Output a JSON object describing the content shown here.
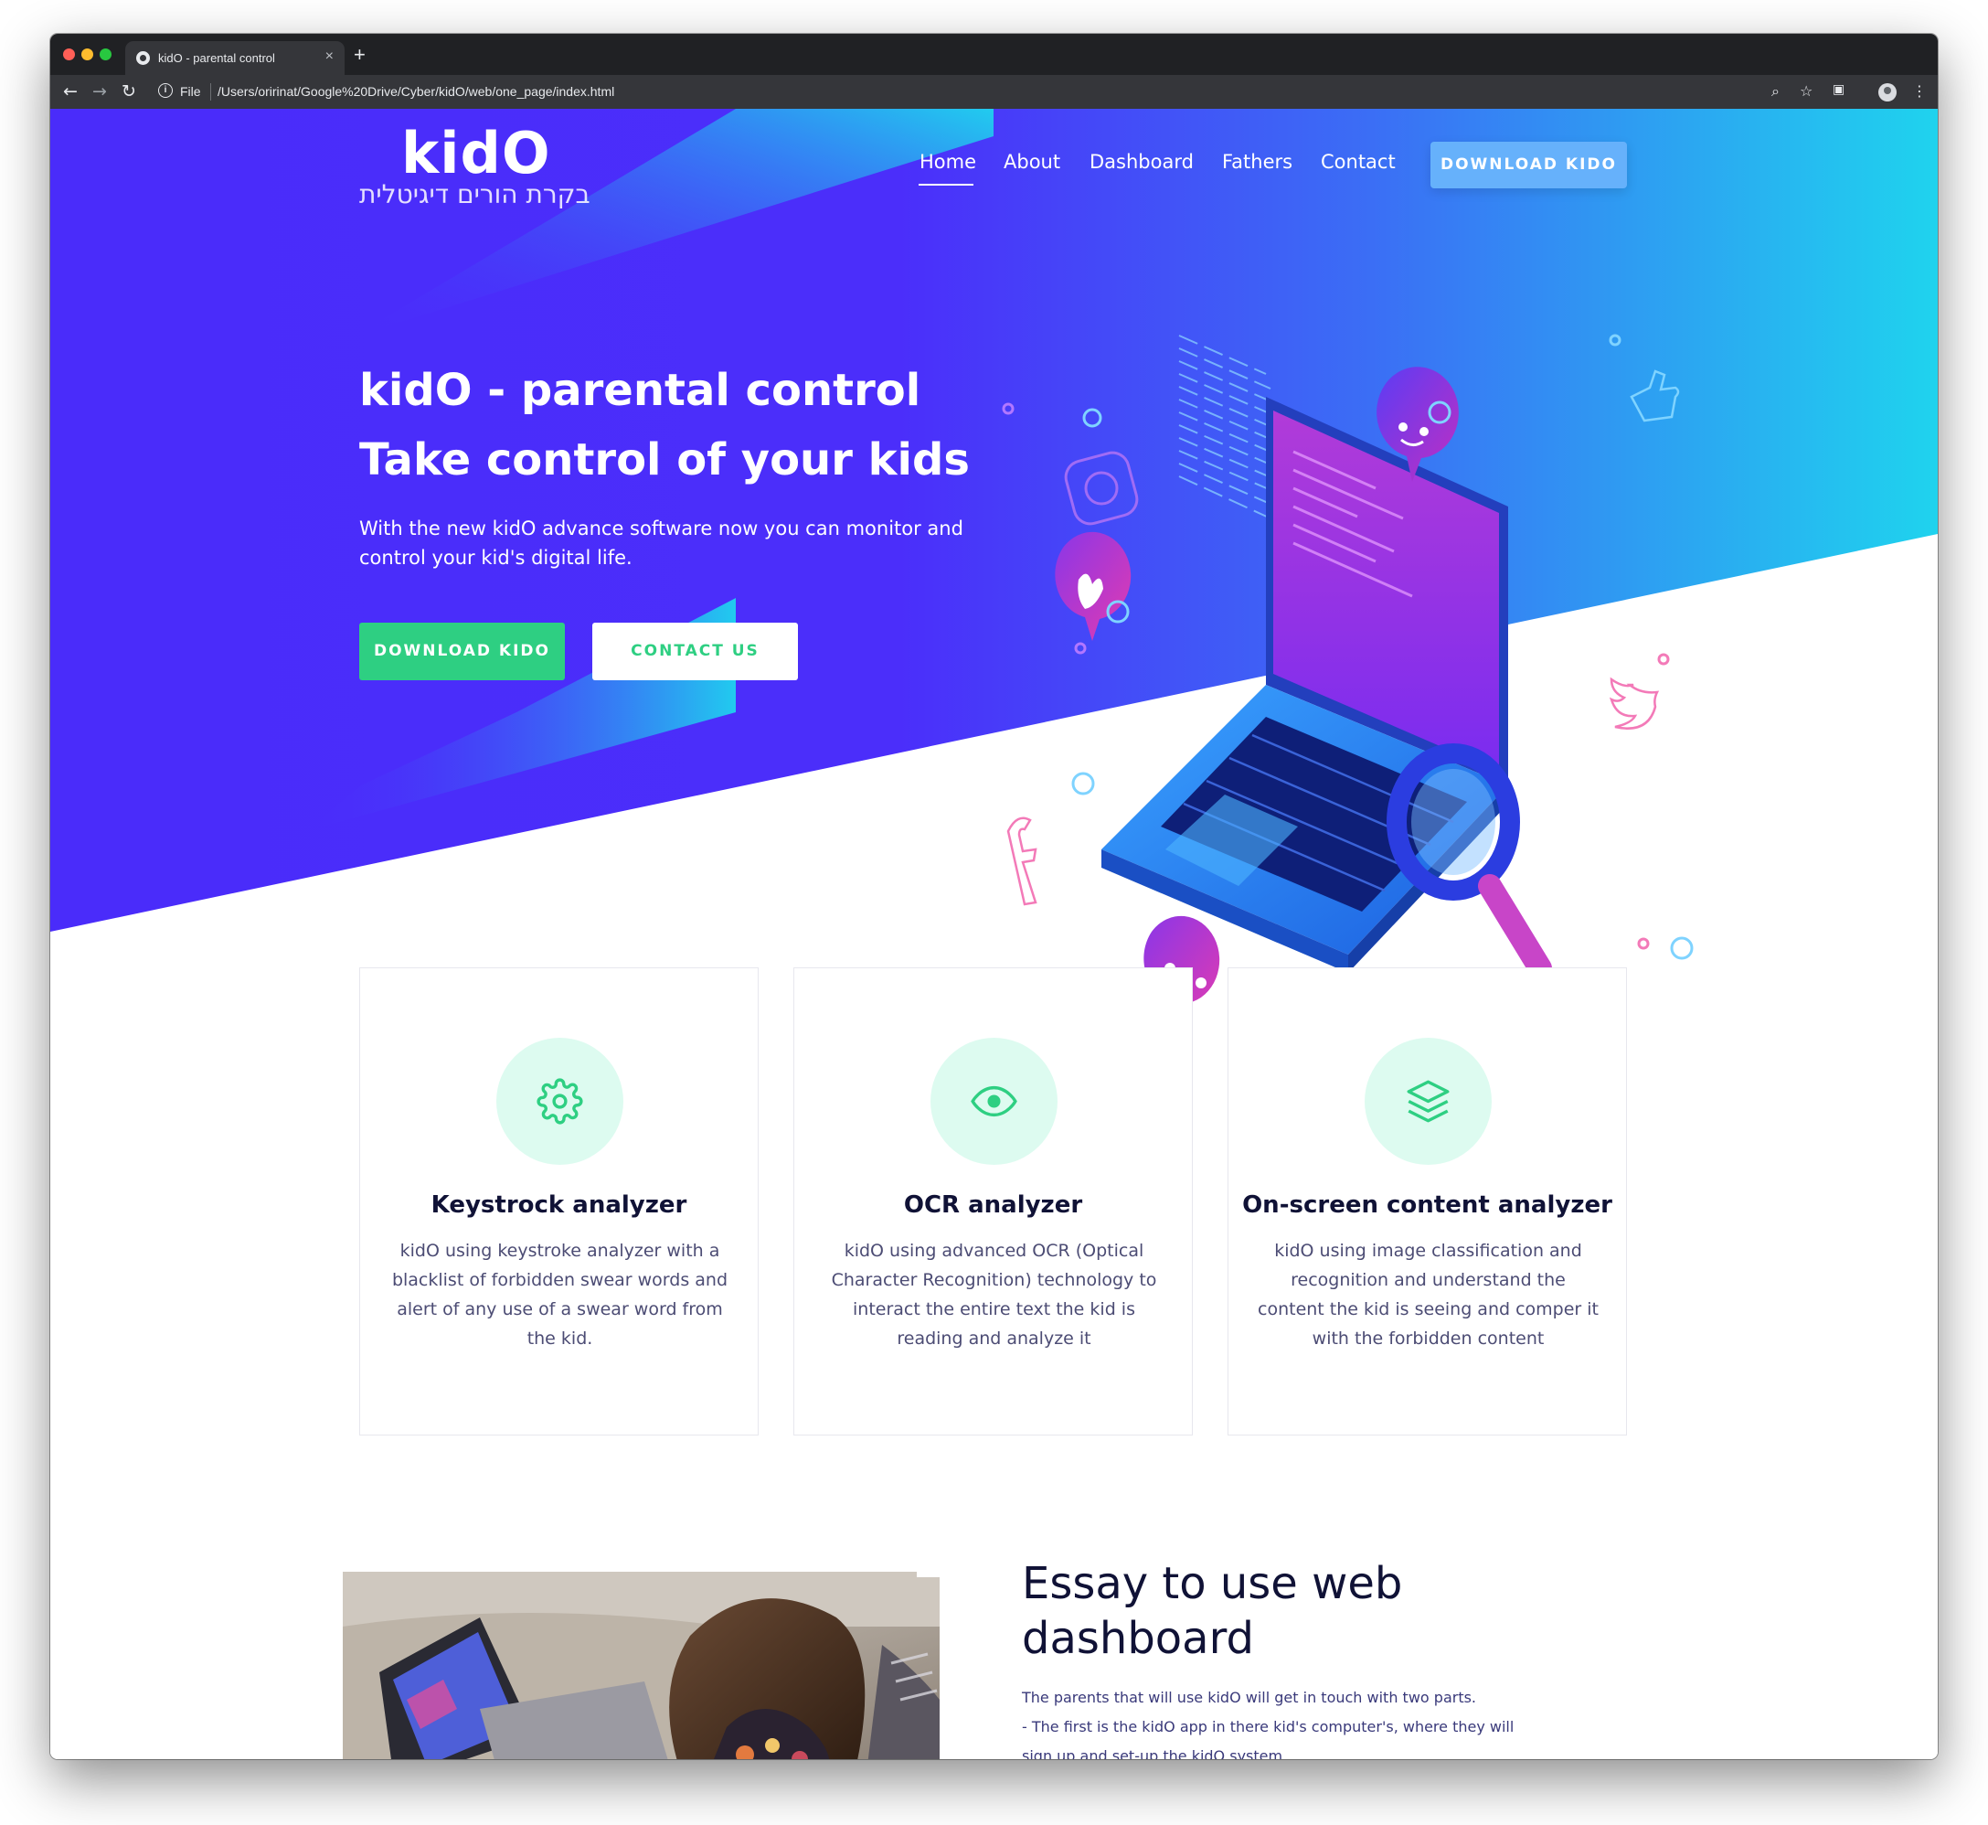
{
  "browser": {
    "tab_title": "kidO - parental control",
    "tab_close": "×",
    "new_tab": "+",
    "omnibox_info": "i",
    "omnibox_scheme": "File",
    "url": "/Users/oririnat/Google%20Drive/Cyber/kidO/web/one_page/index.html"
  },
  "site": {
    "brand": "kidO",
    "tagline": "בקרת הורים דיגיטלית",
    "nav": [
      "Home",
      "About",
      "Dashboard",
      "Fathers",
      "Contact"
    ],
    "nav_button": "DOWNLOAD KIDO"
  },
  "hero": {
    "title_line1": "kidO - parental control",
    "title_line2": "Take control of your kids",
    "text": "With the new kidO advance software now you can monitor and control your kid's digital life.",
    "primary_button": "DOWNLOAD KIDO",
    "secondary_button": "CONTACT US"
  },
  "features": [
    {
      "icon": "gear-icon",
      "title": "Keystrock analyzer",
      "text": "kidO using keystroke analyzer with a blacklist of forbidden swear words and alert of any use of a swear word from the kid."
    },
    {
      "icon": "eye-icon",
      "title": "OCR analyzer",
      "text": "kidO using advanced OCR (Optical Character Recognition) technology to interact the entire text the kid is reading and analyze it"
    },
    {
      "icon": "layers-icon",
      "title": "On-screen content analyzer",
      "text": "kidO using image classification and recognition and understand the content the kid is seeing and comper it with the forbidden content"
    }
  ],
  "essay": {
    "title_line1": "Essay to use web",
    "title_line2": "dashboard",
    "line1": "The parents that will use kidO will get in touch with two parts.",
    "line2": "- The first is the kidO app in there kid's computer's, where they will",
    "line3": "sign up and set-up the kidO system."
  },
  "colors": {
    "hero_purple": "#4a2cfa",
    "hero_cyan": "#1fd3ee",
    "accent_green": "#2ecf82",
    "nav_button": "#66b1fb",
    "heading_dark": "#101236"
  }
}
